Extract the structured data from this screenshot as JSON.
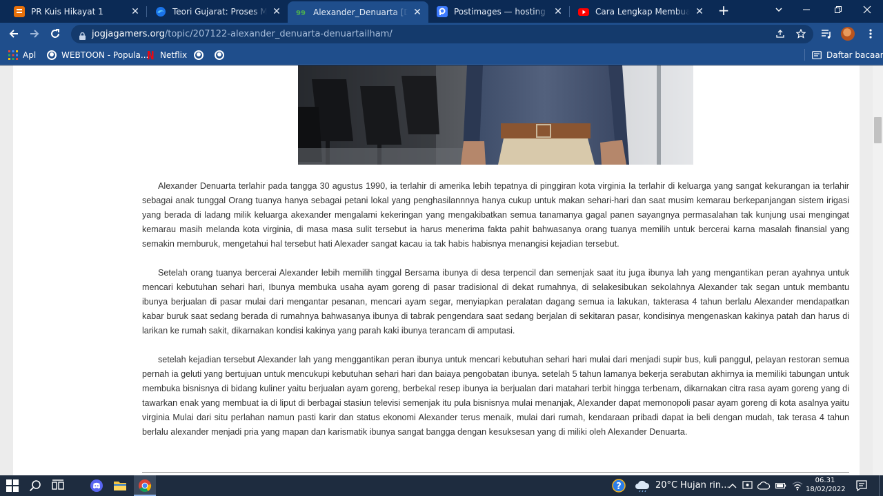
{
  "browser": {
    "tabs": [
      {
        "title": "PR Kuis Hikayat 1",
        "icon": "google-forms-icon",
        "color": "#e8710a"
      },
      {
        "title": "Teori Gujarat: Proses Masuknya",
        "icon": "edge-globe-icon",
        "color": "#1a73e8"
      },
      {
        "title": "Alexander_Denuarta [Denuarta",
        "icon": "jogjagamers-icon",
        "color": "#4caf50"
      },
      {
        "title": "Postimages — hosting gambar",
        "icon": "postimages-icon",
        "color": "#3d7bff"
      },
      {
        "title": "Cara Lengkap Membuat Chara",
        "icon": "youtube-icon",
        "color": "#ff0000"
      }
    ],
    "active_tab": 2,
    "close_glyph": "✕",
    "new_tab_glyph": "+",
    "url": {
      "host": "jogjagamers.org",
      "path": "/topic/207122-alexander_denuarta-denuartailham/"
    },
    "bookmarks": [
      {
        "label": "Apl",
        "icon": "apps-grid-icon"
      },
      {
        "label": "WEBTOON - Popula...",
        "icon": "webtoon-icon"
      },
      {
        "label": "Netflix",
        "icon": "netflix-icon"
      },
      {
        "label": "",
        "icon": "globe-icon"
      },
      {
        "label": "",
        "icon": "globe-icon"
      }
    ],
    "reading_list_label": "Daftar bacaan"
  },
  "article": {
    "paragraphs": [
      "Alexander Denuarta terlahir pada tangga 30 agustus 1990, ia terlahir di amerika lebih tepatnya di pinggiran kota virginia Ia terlahir di keluarga yang sangat kekurangan ia terlahir sebagai anak tunggal Orang tuanya hanya sebagai petani lokal yang penghasilannnya hanya cukup untuk makan sehari-hari dan saat musim kemarau berkepanjangan sistem irigasi yang berada di ladang milik keluarga akexander mengalami kekeringan yang mengakibatkan semua tanamanya gagal panen sayangnya permasalahan tak kunjung usai mengingat kemarau masih melanda kota virginia, di masa masa sulit tersebut ia harus menerima fakta pahit bahwasanya orang tuanya memilih untuk bercerai karna masalah finansial yang semakin memburuk, mengetahui hal tersebut hati Alexader sangat kacau ia tak habis habisnya menangisi kejadian tersebut.",
      "Setelah orang tuanya bercerai Alexander lebih memilih tinggal Bersama ibunya di desa terpencil dan semenjak saat itu juga ibunya lah yang mengantikan peran ayahnya untuk mencari kebutuhan sehari hari, Ibunya membuka usaha ayam goreng di pasar tradisional di dekat rumahnya, di selakesibukan sekolahnya Alexander tak segan untuk membantu ibunya berjualan di pasar mulai dari mengantar pesanan, mencari ayam segar, menyiapkan peralatan dagang semua ia lakukan, takterasa 4 tahun berlalu Alexander mendapatkan kabar buruk saat sedang berada di rumahnya bahwasanya ibunya di tabrak pengendara saat sedang berjalan di sekitaran pasar, kondisinya mengenaskan kakinya patah dan harus di larikan ke rumah sakit, dikarnakan kondisi kakinya yang parah kaki ibunya terancam di amputasi.",
      "setelah kejadian tersebut Alexander lah yang menggantikan peran ibunya untuk mencari kebutuhan sehari hari mulai dari menjadi supir bus, kuli panggul, pelayan restoran semua pernah ia geluti yang bertujuan untuk mencukupi kebutuhan sehari hari dan baiaya pengobatan ibunya. setelah 5 tahun lamanya bekerja serabutan akhirnya ia memiliki tabungan untuk membuka bisnisnya di bidang kuliner yaitu berjualan ayam goreng, berbekal resep ibunya ia berjualan dari matahari terbit hingga terbenam, dikarnakan citra rasa ayam goreng yang di tawarkan enak yang membuat ia di liput di berbagai stasiun televisi semenjak itu pula bisnisnya mulai menanjak, Alexander dapat memonopoli pasar ayam goreng di kota asalnya yaitu virginia Mulai dari situ perlahan namun pasti karir dan status ekonomi Alexander terus menaik, mulai dari rumah, kendaraan pribadi dapat ia beli dengan mudah, tak terasa 4 tahun berlalu alexander menjadi pria yang mapan dan karismatik ibunya sangat bangga dengan kesuksesan yang di miliki oleh Alexander Denuarta."
    ]
  },
  "taskbar": {
    "apps": [
      "windows-start-icon",
      "search-icon",
      "task-view-icon",
      "discord-icon",
      "file-explorer-icon",
      "chrome-icon"
    ],
    "weather": {
      "temp": "20°C",
      "desc": "Hujan rin..."
    },
    "time": "06.31",
    "date": "18/02/2022"
  },
  "colors": {
    "tabstrip_bg": "#0b2a55",
    "toolbar_bg": "#1f4e8c",
    "taskbar_bg": "#1e2c3f",
    "article_text": "#333333"
  }
}
